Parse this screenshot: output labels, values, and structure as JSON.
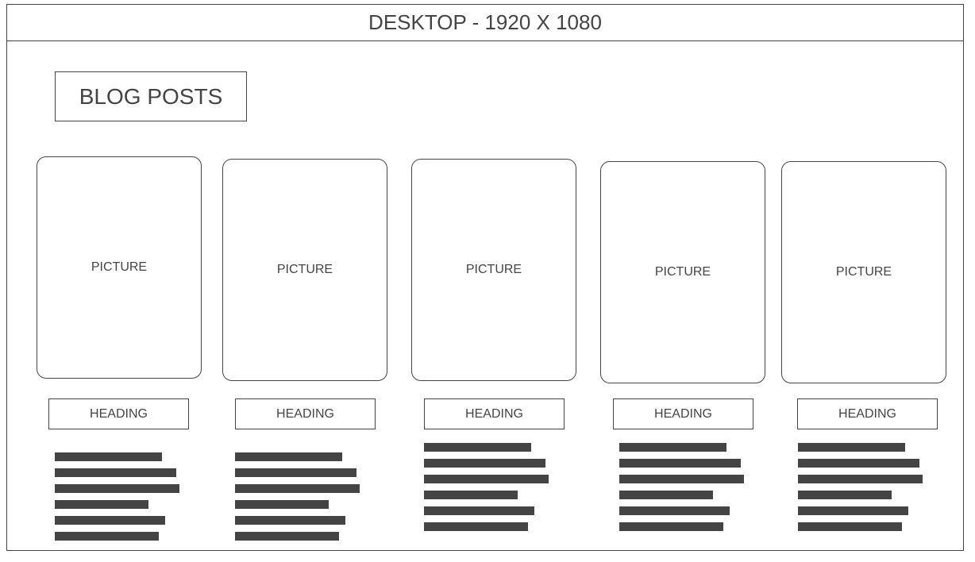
{
  "window": {
    "title": "DESKTOP - 1920 X 1080"
  },
  "section": {
    "label": "BLOG POSTS"
  },
  "posts": [
    {
      "picture_label": "PICTURE",
      "heading": "HEADING"
    },
    {
      "picture_label": "PICTURE",
      "heading": "HEADING"
    },
    {
      "picture_label": "PICTURE",
      "heading": "HEADING"
    },
    {
      "picture_label": "PICTURE",
      "heading": "HEADING"
    },
    {
      "picture_label": "PICTURE",
      "heading": "HEADING"
    }
  ],
  "colors": {
    "stroke": "#444444",
    "background": "#ffffff"
  }
}
